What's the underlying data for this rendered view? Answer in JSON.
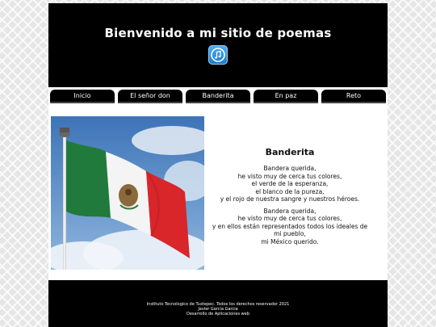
{
  "header": {
    "title": "Bienvenido a mi sitio de poemas",
    "icon": "itunes-music-icon"
  },
  "nav": {
    "items": [
      {
        "label": "Inicio"
      },
      {
        "label": "El señor don tecolote"
      },
      {
        "label": "Banderita"
      },
      {
        "label": "En paz"
      },
      {
        "label": "Reto"
      }
    ]
  },
  "main": {
    "image_subject": "mexican-flag",
    "poem": {
      "title": "Banderita",
      "stanzas": [
        [
          "Bandera querida,",
          "he visto muy de cerca tus colores,",
          "el verde de la esperanza,",
          "el blanco de la pureza,",
          "y el rojo de nuestra sangre y nuestros héroes."
        ],
        [
          "Bandera querida,",
          "he visto muy de cerca tus colores,",
          "y en ellos están representados todos los ideales de mi pueblo,",
          "mi México querido."
        ]
      ]
    }
  },
  "footer": {
    "lines": [
      "Instituto Tecnologico de Tuxtepec. Todos los derechos reservador 2021",
      "Javier Garcia Garcia",
      "Desarrollo de Aplicaciones web"
    ]
  },
  "colors": {
    "header_bg": "#000000",
    "flag_green": "#1f7a3c",
    "flag_red": "#d8262a",
    "sky": "#4f86c6"
  }
}
